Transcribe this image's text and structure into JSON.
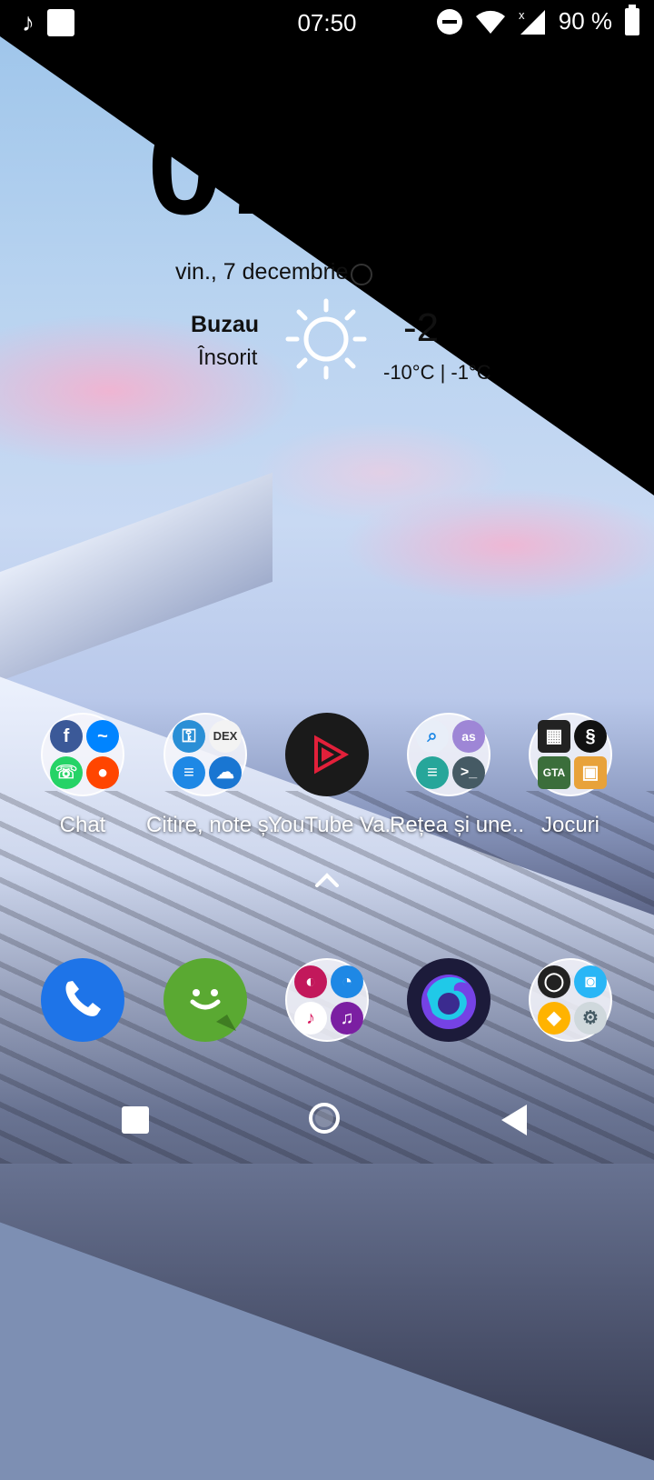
{
  "status_bar": {
    "time": "07:50",
    "battery_text": "90 %",
    "left_icons": [
      "music-note-icon",
      "square-notification-icon"
    ],
    "right_icons": [
      "do-not-disturb-icon",
      "wifi-icon",
      "cell-signal-no-data-icon",
      "battery-icon"
    ]
  },
  "clock_widget": {
    "time_fragment": "07",
    "date": "vin., 7 decembrie",
    "city": "Buzau",
    "condition": "Însorit",
    "temperature": "-2",
    "range": "-10°C | -1°C",
    "weather_icon": "sun-icon"
  },
  "apps": [
    {
      "label": "Chat",
      "type": "folder",
      "icons": [
        "facebook-icon",
        "messenger-icon",
        "whatsapp-icon",
        "reddit-icon"
      ]
    },
    {
      "label": "Citire, note ș..",
      "type": "folder",
      "icons": [
        "lock-app-icon",
        "dex-dictionary-icon",
        "notes-icon",
        "onedrive-icon"
      ]
    },
    {
      "label": "YouTube Va..",
      "type": "app",
      "icons": [
        "youtube-vanced-icon"
      ]
    },
    {
      "label": "Rețea și une..",
      "type": "folder",
      "icons": [
        "search-tool-icon",
        "keyboard-icon",
        "menu-app-icon",
        "terminal-icon"
      ]
    },
    {
      "label": "Jocuri",
      "type": "folder",
      "icons": [
        "game-tetris-icon",
        "game-snake-icon",
        "gta-icon",
        "puzzle-game-icon"
      ]
    }
  ],
  "dock": [
    {
      "name": "phone",
      "icon": "phone-icon"
    },
    {
      "name": "messaging",
      "icon": "messaging-icon"
    },
    {
      "name": "media-folder",
      "icon": "media-folder-icon"
    },
    {
      "name": "firefox",
      "icon": "firefox-icon"
    },
    {
      "name": "tools-folder",
      "icon": "tools-folder-icon"
    }
  ],
  "colors": {
    "phone": "#1e74e8",
    "messaging": "#5aa932",
    "facebook": "#3b5998",
    "messenger": "#0084ff",
    "whatsapp": "#25d366",
    "reddit": "#ff4500"
  }
}
